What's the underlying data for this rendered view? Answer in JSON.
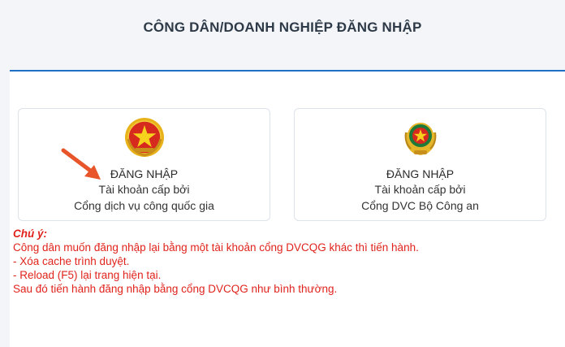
{
  "header": {
    "title": "CÔNG DÂN/DOANH NGHIỆP ĐĂNG NHẬP"
  },
  "cards": [
    {
      "icon": "national-emblem-icon",
      "title": "ĐĂNG NHẬP",
      "line1": "Tài khoản cấp bởi",
      "line2": "Cổng dịch vụ công quốc gia"
    },
    {
      "icon": "police-emblem-icon",
      "title": "ĐĂNG NHẬP",
      "line1": "Tài khoản cấp bởi",
      "line2": "Cổng DVC Bộ Công an"
    }
  ],
  "notes": {
    "title": "Chú ý:",
    "lines": [
      "Công dân muốn đăng nhập lại bằng một tài khoản cổng DVCQG khác thì tiến hành.",
      "- Xóa cache trình duyệt.",
      "- Reload (F5) lại trang hiện tại.",
      "Sau đó tiến hành đăng nhập bằng cổng DVCQG như bình thường."
    ]
  },
  "colors": {
    "accent": "#1f6fc4",
    "warning_text": "#e0231c",
    "arrow": "#e8552a"
  }
}
